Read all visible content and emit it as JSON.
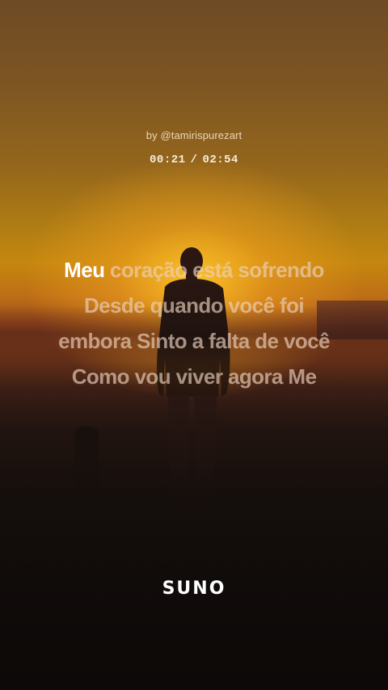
{
  "credit": {
    "prefix": "by",
    "handle": "@tamirispurezart"
  },
  "playback": {
    "current": "00:21",
    "separator": "/",
    "total": "02:54"
  },
  "lyrics": {
    "line1_active": "Meu",
    "line1_rest": "coração está sofrendo",
    "line2": "Desde quando você foi",
    "line3": "embora Sinto a falta de você",
    "line4": "Como vou viver agora Me"
  },
  "brand": {
    "logo": "SUNO"
  },
  "colors": {
    "sun": "#f2a01e",
    "sky_top": "#6e4a25",
    "ground": "#180f0c",
    "lyric_active": "#ffffff"
  }
}
